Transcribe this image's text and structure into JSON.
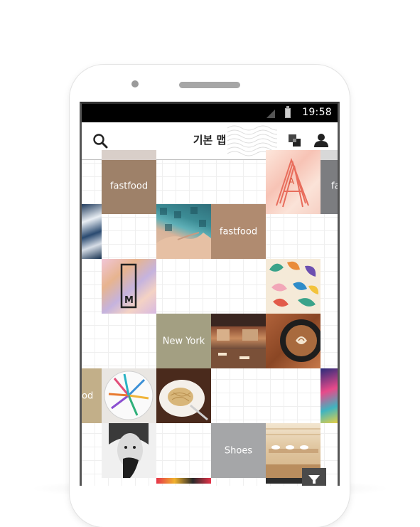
{
  "status_bar": {
    "time": "19:58"
  },
  "app_bar": {
    "title": "기본 맵"
  },
  "tiles": {
    "fastfood_1": "fastfood",
    "fastfood_2": "fastfood",
    "fa_partial": "fa",
    "new_york": "New York",
    "od_partial": "od",
    "shoes": "Shoes",
    "m_letter": "M",
    "a_letter": "A"
  },
  "colors": {
    "fastfood_tile": "#9e8169",
    "fastfood_tile_2": "#b08b70",
    "new_york_tile": "#a39f82",
    "shoes_tile": "#a5a6a8",
    "gray_tile": "#7c7d80",
    "tan_tile": "#c2af89"
  }
}
